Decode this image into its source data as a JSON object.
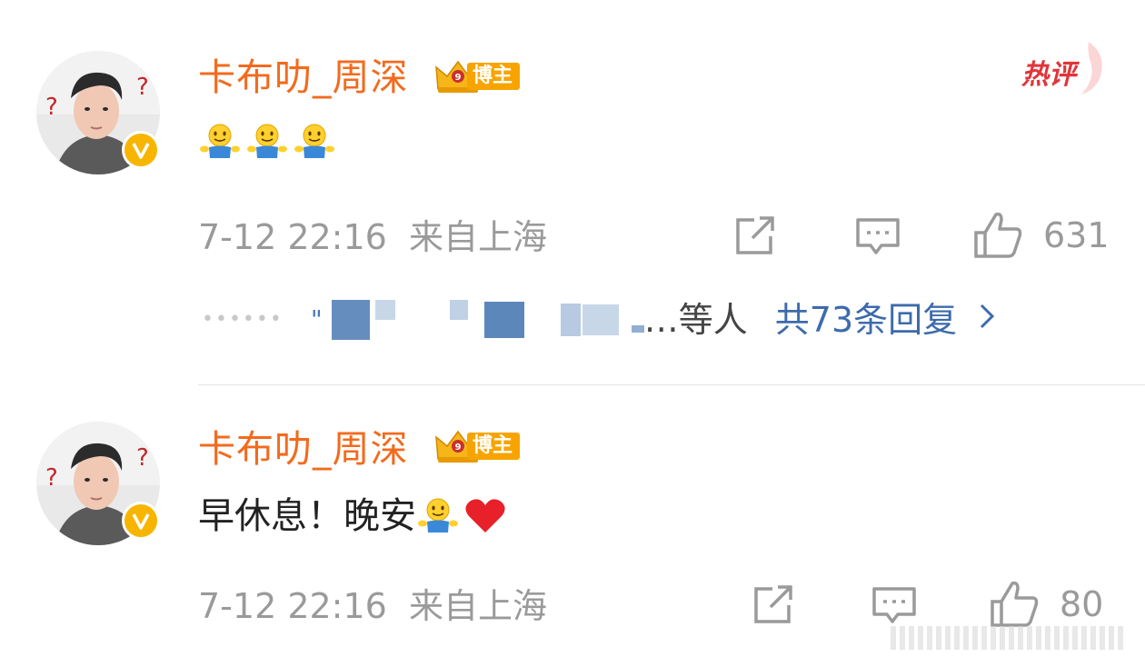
{
  "comments": [
    {
      "username": "卡布叻_周深",
      "badge_label": "博主",
      "hot_label": "热评",
      "content_text": "",
      "emojis": [
        "smile-hug",
        "smile-hug",
        "smile-hug"
      ],
      "time": "7-12 22:16",
      "location": "来自上海",
      "likes": "631",
      "reply_suffix": "…等人",
      "reply_link": "共73条回复"
    },
    {
      "username": "卡布叻_周深",
      "badge_label": "博主",
      "content_text": "早休息！晚安",
      "emojis": [
        "smile-hug",
        "red-heart"
      ],
      "time": "7-12 22:16",
      "location": "来自上海",
      "likes": "80"
    }
  ],
  "colors": {
    "username": "#f26b1d",
    "badge": "#f7a400",
    "link": "#3d6bac",
    "meta": "#9a9a9a"
  }
}
